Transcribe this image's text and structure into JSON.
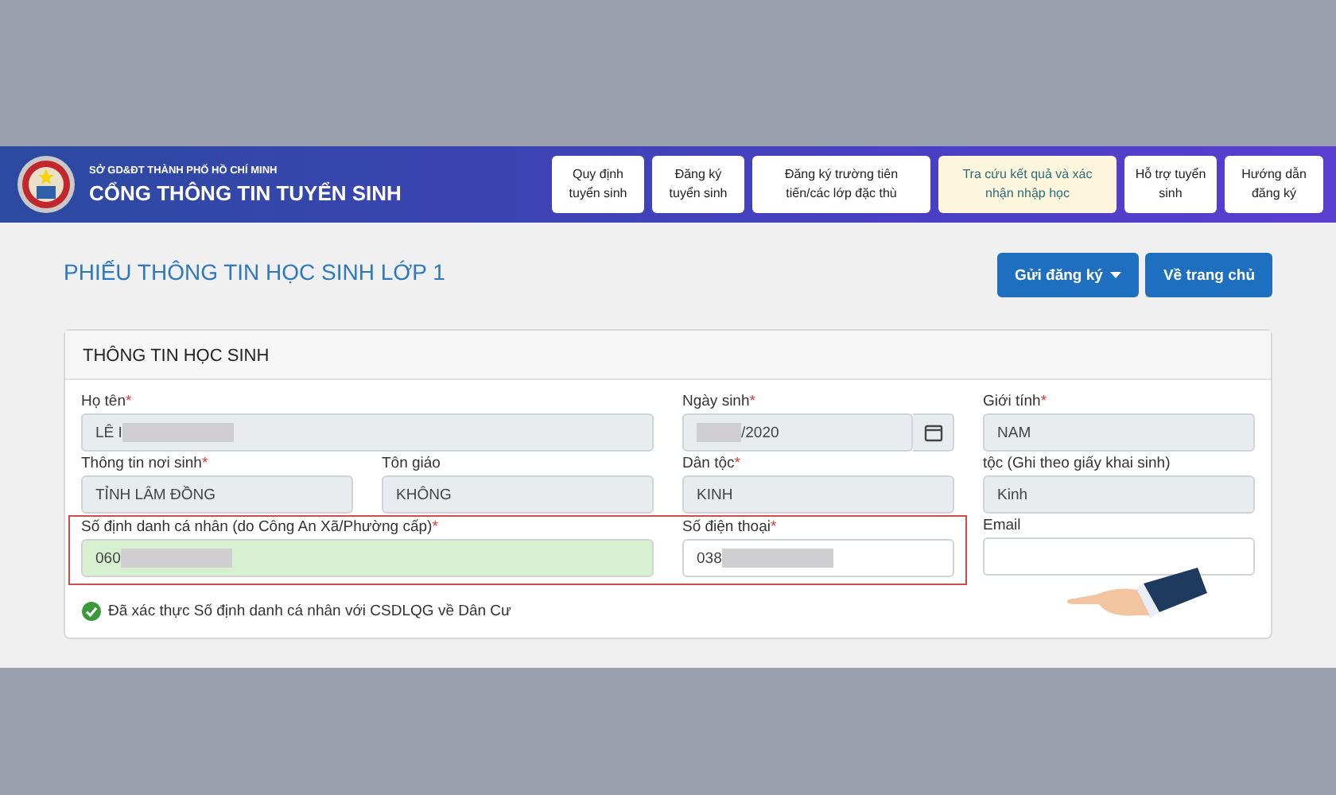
{
  "header": {
    "agency": "SỞ GD&ĐT THÀNH PHỐ HỒ CHÍ MINH",
    "title": "CỔNG THÔNG TIN TUYỂN SINH"
  },
  "nav": [
    {
      "label": "Quy định tuyển sinh",
      "selected": false
    },
    {
      "label": "Đăng ký tuyển sinh",
      "selected": false
    },
    {
      "label": "Đăng ký trường tiên tiến/các lớp đặc thù",
      "selected": false
    },
    {
      "label": "Tra cứu kết quả và xác nhận nhập học",
      "selected": true
    },
    {
      "label": "Hỗ trợ tuyển sinh",
      "selected": false
    },
    {
      "label": "Hướng dẫn đăng ký",
      "selected": false
    }
  ],
  "page_title": "PHIẾU THÔNG TIN HỌC SINH LỚP 1",
  "actions": [
    {
      "label": "Gửi đăng ký",
      "dropdown": true
    },
    {
      "label": "Về trang chủ",
      "dropdown": false
    }
  ],
  "card": {
    "title": "THÔNG TIN HỌC SINH",
    "sections": [
      {
        "highlighted": false,
        "fields": [
          {
            "label": "Họ tên",
            "mark": "*",
            "value": "LÊ I",
            "kind": "wide",
            "disabled": true,
            "redacted": true,
            "valid": false
          },
          {
            "label": "Ngày sinh",
            "mark": "*",
            "value": "/2020",
            "kind": "date",
            "disabled": true,
            "redacted": true,
            "valid": false
          },
          {
            "label": "Giới tính",
            "mark": "*",
            "value": "NAM",
            "kind": "text",
            "disabled": true,
            "redacted": false,
            "valid": false
          },
          {
            "label": "Thông tin nơi sinh",
            "mark": "*",
            "value": "TỈNH LÂM ĐỒNG",
            "kind": "text",
            "disabled": true,
            "redacted": false,
            "valid": false
          },
          {
            "label": "Tôn giáo",
            "value": "KHÔNG",
            "kind": "text",
            "disabled": true,
            "redacted": false,
            "valid": false
          },
          {
            "label": "Dân tộc",
            "mark": "*",
            "value": "KINH",
            "kind": "text",
            "disabled": true,
            "redacted": false,
            "valid": false
          },
          {
            "label": "tộc (Ghi theo giấy khai sinh)",
            "value": "Kinh",
            "kind": "text",
            "disabled": true,
            "redacted": false,
            "valid": false
          }
        ]
      },
      {
        "highlighted": true,
        "fields": [
          {
            "label": "Số định danh cá nhân (do Công An Xã/Phường cấp)",
            "mark": "*",
            "value": "060",
            "kind": "wide",
            "disabled": false,
            "redacted": true,
            "valid": true
          },
          {
            "label": "Số điện thoại",
            "mark": "*",
            "value": "038",
            "kind": "text",
            "disabled": false,
            "redacted": true,
            "valid": false
          }
        ]
      },
      {
        "highlighted": false,
        "fields": [
          {
            "label": "Email",
            "kind": "text",
            "disabled": false,
            "redacted": false,
            "valid": false
          }
        ]
      }
    ],
    "verification": {
      "text": "Đã xác thực Số định danh cá nhân với CSDLQG về Dân Cư",
      "checked": true
    }
  }
}
